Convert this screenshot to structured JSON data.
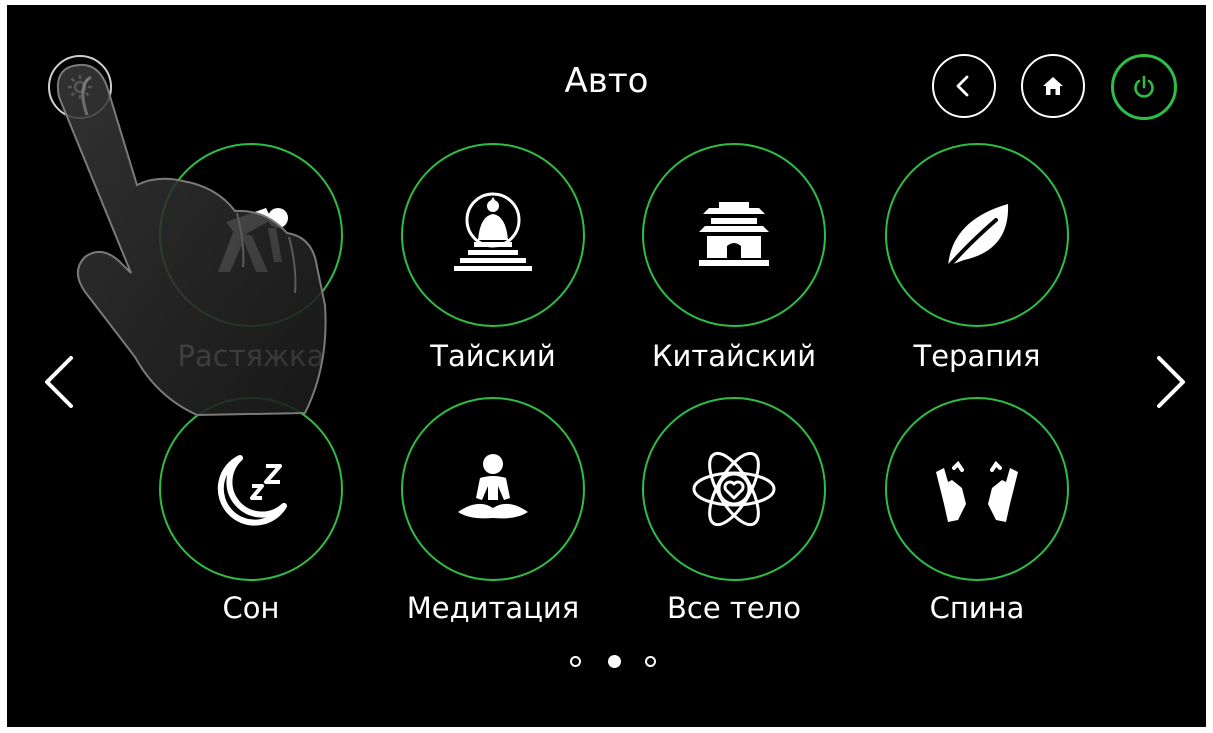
{
  "header": {
    "title": "Авто",
    "settings_icon": "gear-icon",
    "back_icon": "chevron-left-icon",
    "home_icon": "home-icon",
    "power_icon": "power-icon"
  },
  "modes": [
    {
      "label": "Растяжка",
      "icon": "stretch-person-icon"
    },
    {
      "label": "Тайский",
      "icon": "buddha-icon"
    },
    {
      "label": "Китайский",
      "icon": "pagoda-icon"
    },
    {
      "label": "Терапия",
      "icon": "leaf-icon"
    },
    {
      "label": "Сон",
      "icon": "moon-zz-icon"
    },
    {
      "label": "Медитация",
      "icon": "meditation-icon"
    },
    {
      "label": "Все тело",
      "icon": "atom-heart-icon"
    },
    {
      "label": "Спина",
      "icon": "hands-icon"
    }
  ],
  "pagination": {
    "pages": 3,
    "current": 2
  },
  "colors": {
    "accent": "#2fbd45",
    "background": "#000000",
    "text": "#ffffff"
  }
}
